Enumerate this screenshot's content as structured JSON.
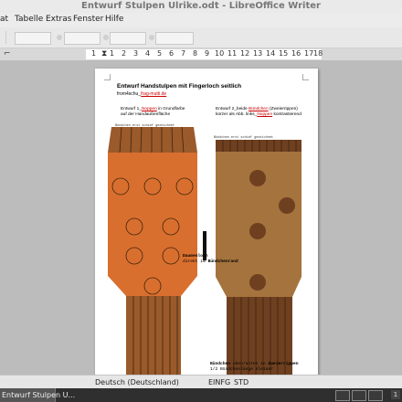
{
  "window": {
    "title": "Entwurf Stulpen Ulrike.odt - LibreOffice Writer"
  },
  "menu": [
    {
      "label": "at"
    },
    {
      "label": "Tabelle"
    },
    {
      "label": "Extras"
    },
    {
      "label": "Fenster"
    },
    {
      "label": "Hilfe"
    }
  ],
  "ruler": {
    "ticks": [
      "1",
      "1",
      "2",
      "3",
      "4",
      "5",
      "6",
      "7",
      "8",
      "9",
      "10",
      "11",
      "12",
      "13",
      "14",
      "15",
      "16",
      "17",
      "18"
    ]
  },
  "document": {
    "heading": "Entwurf Handstulpen mit Fingerloch seitlich",
    "source_prefix": "from4schu_",
    "source_link": "frag-mutti.de",
    "design1": {
      "prefix": "Entwurf 1_",
      "link": "Noppen",
      "rest": " in Grundfarbe",
      "line2": "auf der Handaußenfläche"
    },
    "design2": {
      "prefix": "Entwurf 2_beide ",
      "link": "Bündchen",
      "rest": " (Zweierrippen)",
      "line2_prefix": "kürzer als Abb. links_",
      "line2_link": "Noppen",
      "line2_rest": " kontrastierend"
    },
    "tiny1": "Bündchen erst schief gezeichnet",
    "tiny2": "Bündchen erst schief gezeichnet",
    "thumb_label": "Daumenloch",
    "thumb_note_prefix": "direkt im",
    "thumb_note_bold": "Bündchenrand",
    "bottom_note_bold1": "Bündchen",
    "bottom_note_mid": " oben/unten in ",
    "bottom_note_bold2": "Zweierrippen",
    "bottom_note_line2": "1/2 Bündchenlänge kleiner"
  },
  "colors": {
    "mitten1_main": "#d96f2e",
    "mitten1_cuff": "#9a5a2a",
    "mitten2_main": "#a5733d",
    "mitten2_cuff": "#6e4020",
    "rib_line": "#3d2410",
    "thumb_hole": "#111111"
  },
  "status": {
    "language": "Deutsch (Deutschland)",
    "insert_mode": "EINFG",
    "selection_mode": "STD"
  },
  "taskbar": {
    "item": "Entwurf Stulpen U...",
    "workspace": "1"
  }
}
